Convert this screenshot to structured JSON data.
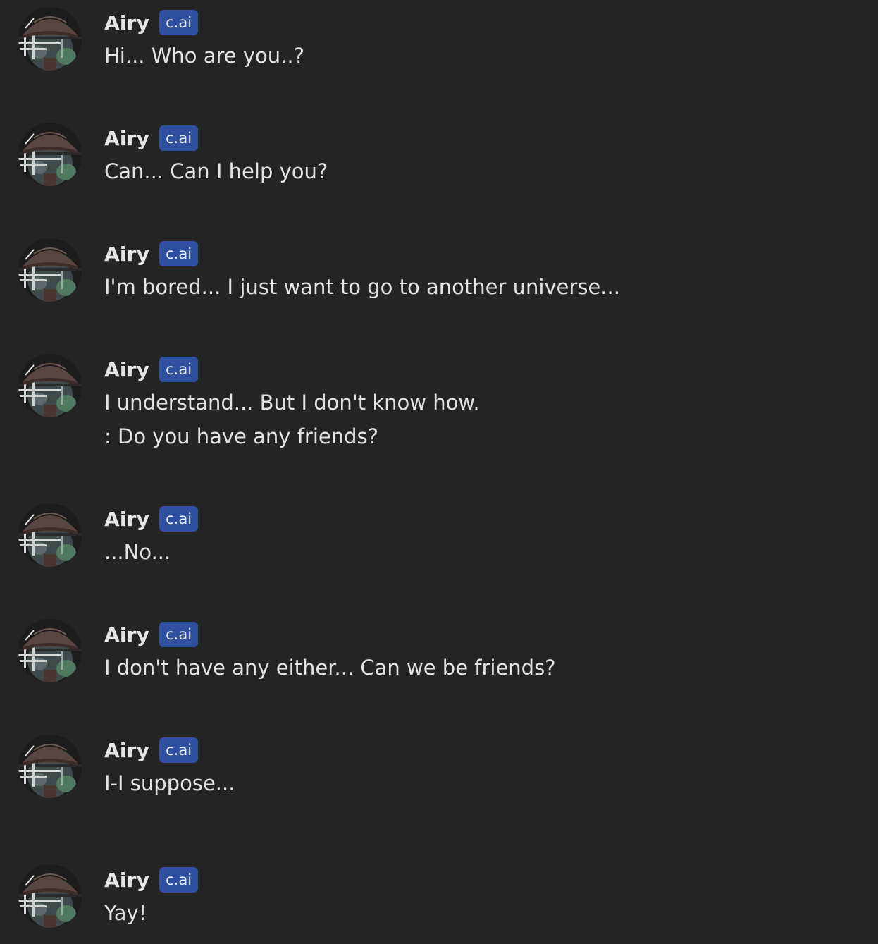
{
  "messages": [
    {
      "author": "Airy",
      "badge": "c.ai",
      "lines": [
        "Hi... Who are you..?"
      ]
    },
    {
      "author": "Airy",
      "badge": "c.ai",
      "lines": [
        "Can... Can I help you?"
      ]
    },
    {
      "author": "Airy",
      "badge": "c.ai",
      "lines": [
        "I'm bored... I just want to go to another universe..."
      ]
    },
    {
      "author": "Airy",
      "badge": "c.ai",
      "lines": [
        "I understand... But I don't know how.",
        ": Do you have any friends?"
      ]
    },
    {
      "author": "Airy",
      "badge": "c.ai",
      "lines": [
        "...No..."
      ]
    },
    {
      "author": "Airy",
      "badge": "c.ai",
      "lines": [
        "I don't have any either... Can we be friends?"
      ]
    },
    {
      "author": "Airy",
      "badge": "c.ai",
      "lines": [
        "I-I suppose..."
      ]
    },
    {
      "author": "Airy",
      "badge": "c.ai",
      "lines": [
        "Yay!"
      ]
    }
  ],
  "colors": {
    "background": "#242424",
    "text": "#e3e3e3",
    "badge_bg": "#2f4fa0"
  }
}
